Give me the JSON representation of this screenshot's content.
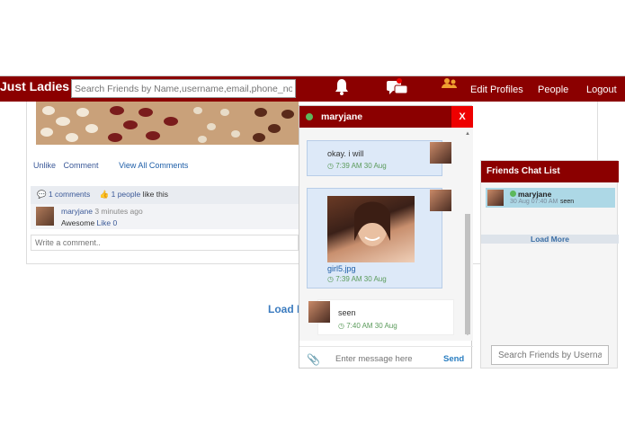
{
  "nav": {
    "brand": "Just Ladies",
    "search_placeholder": "Search Friends by Name,username,email,phone_no,username",
    "edit_profiles": "Edit Profiles",
    "people": "People",
    "logout": "Logout",
    "icons": [
      "bell-icon",
      "chat-icon",
      "people-icon"
    ]
  },
  "post": {
    "actions": {
      "unlike": "Unlike",
      "comment": "Comment",
      "view_all": "View All Comments"
    },
    "stats": {
      "comments": "1 comments",
      "people": "1 people",
      "like_this": "like this"
    },
    "comment": {
      "user": "maryjane",
      "time": "3 minutes ago",
      "text": "Awesome",
      "like": "Like 0"
    },
    "write_placeholder": "Write a comment.."
  },
  "load_more_main": "Load M",
  "chat": {
    "user": "maryjane",
    "close": "X",
    "messages": [
      {
        "text": "okay. i will",
        "time": "7:39 AM 30 Aug"
      },
      {
        "file": "girl5.jpg",
        "time": "7:39 AM 30 Aug"
      },
      {
        "text": "seen",
        "time": "7:40 AM 30 Aug"
      }
    ],
    "input_placeholder": "Enter message here",
    "send": "Send"
  },
  "friends": {
    "title": "Friends Chat List",
    "items": [
      {
        "name": "maryjane",
        "time": "30 Aug 07:40 AM",
        "status": "seen"
      }
    ],
    "load_more": "Load More",
    "search_placeholder": "Search Friends by Username"
  },
  "colors": {
    "brand": "#8b0000",
    "online": "#5cb85c",
    "close": "#ee0000",
    "highlight": "#add8e6"
  }
}
